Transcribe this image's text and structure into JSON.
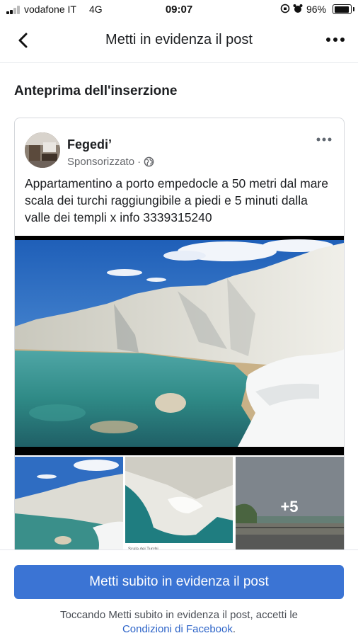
{
  "status_bar": {
    "carrier": "vodafone IT",
    "network": "4G",
    "time": "09:07",
    "battery": "96%",
    "battery_level": 0.96
  },
  "nav": {
    "title": "Metti in evidenza il post",
    "back_icon": "chevron-left-icon",
    "more_icon": "more-horizontal-icon"
  },
  "section": {
    "title": "Anteprima dell'inserzione"
  },
  "post": {
    "page_name": "Fegedi’",
    "sponsored_label": "Sponsorizzato",
    "separator": "·",
    "audience_icon": "globe-icon",
    "text": "Appartamentino a porto empedocle a 50 metri dal mare scala dei turchi raggiungibile a piedi e  5 minuti dalla valle dei templi x info 3339315240",
    "more_photos": "+5",
    "thumb_caption": "Scala dei Turchi"
  },
  "footer": {
    "cta_label": "Metti subito in evidenza il post",
    "terms_prefix": "Toccando Metti subito in evidenza il post, accetti le",
    "terms_link": "Condizioni di Facebook",
    "terms_suffix": "."
  },
  "colors": {
    "primary": "#3b74d4",
    "link": "#2d64c8",
    "secondary_text": "#65676b"
  }
}
